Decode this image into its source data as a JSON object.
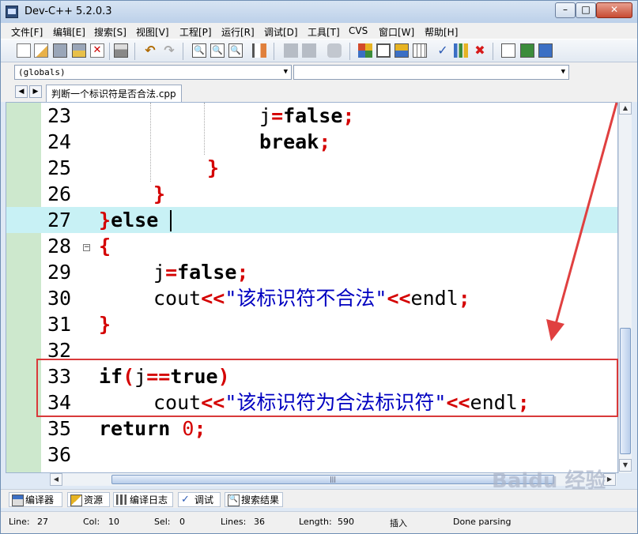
{
  "window": {
    "title": "Dev-C++ 5.2.0.3"
  },
  "menu": [
    "文件[F]",
    "编辑[E]",
    "搜索[S]",
    "视图[V]",
    "工程[P]",
    "运行[R]",
    "调试[D]",
    "工具[T]",
    "CVS",
    "窗口[W]",
    "帮助[H]"
  ],
  "toolbar_icons": [
    "new-file-icon",
    "open-icon",
    "save-icon",
    "save-all-icon",
    "close-file-icon",
    "print-icon",
    "undo-icon",
    "redo-icon",
    "find-icon",
    "replace-icon",
    "find-next-icon",
    "goto-line-icon",
    "back-icon",
    "forward-icon",
    "bookmark-icon",
    "compile-icon",
    "run-icon",
    "compile-run-icon",
    "rebuild-icon",
    "check-syntax-icon",
    "chart-icon",
    "stop-icon",
    "new-project-icon",
    "add-file-icon",
    "remove-file-icon"
  ],
  "combos": {
    "scope": "(globals)",
    "member": ""
  },
  "tab": {
    "label": "判断一个标识符是否合法.cpp"
  },
  "code_lines": [
    {
      "n": "23"
    },
    {
      "n": "24"
    },
    {
      "n": "25"
    },
    {
      "n": "26"
    },
    {
      "n": "27"
    },
    {
      "n": "28"
    },
    {
      "n": "29"
    },
    {
      "n": "30"
    },
    {
      "n": "31"
    },
    {
      "n": "32"
    },
    {
      "n": "33"
    },
    {
      "n": "34"
    },
    {
      "n": "35"
    },
    {
      "n": "36"
    }
  ],
  "code_text": {
    "l23_var": "j",
    "l23_eq": "=",
    "l23_val": "false",
    "l23_semi": ";",
    "l24_kw": "break",
    "l24_semi": ";",
    "l25_brace": "}",
    "l26_brace": "}",
    "l27_brace": "}",
    "l27_kw": "else",
    "l28_brace": "{",
    "l29_var": "j",
    "l29_eq": "=",
    "l29_val": "false",
    "l29_semi": ";",
    "l30_fn": "cout",
    "l30_op": "<<",
    "l30_str": "\"该标识符不合法\"",
    "l30_op2": "<<",
    "l30_end": "endl",
    "l30_semi": ";",
    "l31_brace": "}",
    "l33_kw": "if",
    "l33_p1": "(",
    "l33_var": "j",
    "l33_eq": "==",
    "l33_val": "true",
    "l33_p2": ")",
    "l34_fn": "cout",
    "l34_op": "<<",
    "l34_str": "\"该标识符为合法标识符\"",
    "l34_op2": "<<",
    "l34_end": "endl",
    "l34_semi": ";",
    "l35_kw": "return",
    "l35_num": "0",
    "l35_semi": ";"
  },
  "bottom_tabs": [
    "编译器",
    "资源",
    "编译日志",
    "调试",
    "搜索结果"
  ],
  "status": {
    "line_label": "Line:",
    "line": "27",
    "col_label": "Col:",
    "col": "10",
    "sel_label": "Sel:",
    "sel": "0",
    "lines_label": "Lines:",
    "lines": "36",
    "length_label": "Length:",
    "length": "590",
    "mode": "插入",
    "state": "Done parsing"
  },
  "watermark": "Baidu 经验",
  "colors": {
    "annotation": "#d9393a",
    "current_line": "#c8f1f5",
    "gutter": "#cde8cd"
  }
}
